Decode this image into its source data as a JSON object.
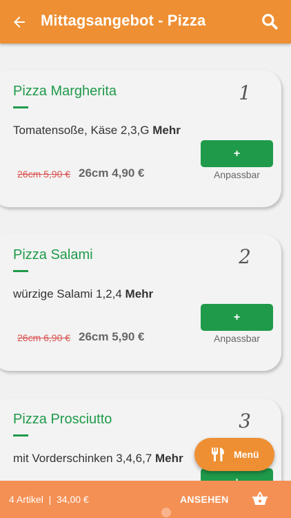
{
  "header": {
    "title": "Mittagsangebot - Pizza"
  },
  "items": [
    {
      "name": "Pizza Margherita",
      "number": "1",
      "description": "Tomatensoße, Käse 2,3,G",
      "more": "Mehr",
      "old_price": "26cm 5,90 €",
      "new_price": "26cm 4,90 €",
      "add_label": "+",
      "customizable": "Anpassbar"
    },
    {
      "name": "Pizza Salami",
      "number": "2",
      "description": "würzige Salami 1,2,4",
      "more": "Mehr",
      "old_price": "26cm 6,90 €",
      "new_price": "26cm 5,90 €",
      "add_label": "+",
      "customizable": "Anpassbar"
    },
    {
      "name": "Pizza Prosciutto",
      "number": "3",
      "description": "mit Vorderschinken 3,4,6,7",
      "more": "Mehr",
      "add_label": "+"
    }
  ],
  "fab": {
    "label": "Menü",
    "icon": "fork-knife-icon"
  },
  "cart": {
    "summary": "4 Artikel  |  34,00 €",
    "view_label": "ANSEHEN",
    "icon": "basket-icon"
  },
  "colors": {
    "primary": "#ee8f33",
    "accent_green": "#1f9a4a",
    "cart_bar": "#f59055",
    "strike_red": "#d9534f"
  }
}
